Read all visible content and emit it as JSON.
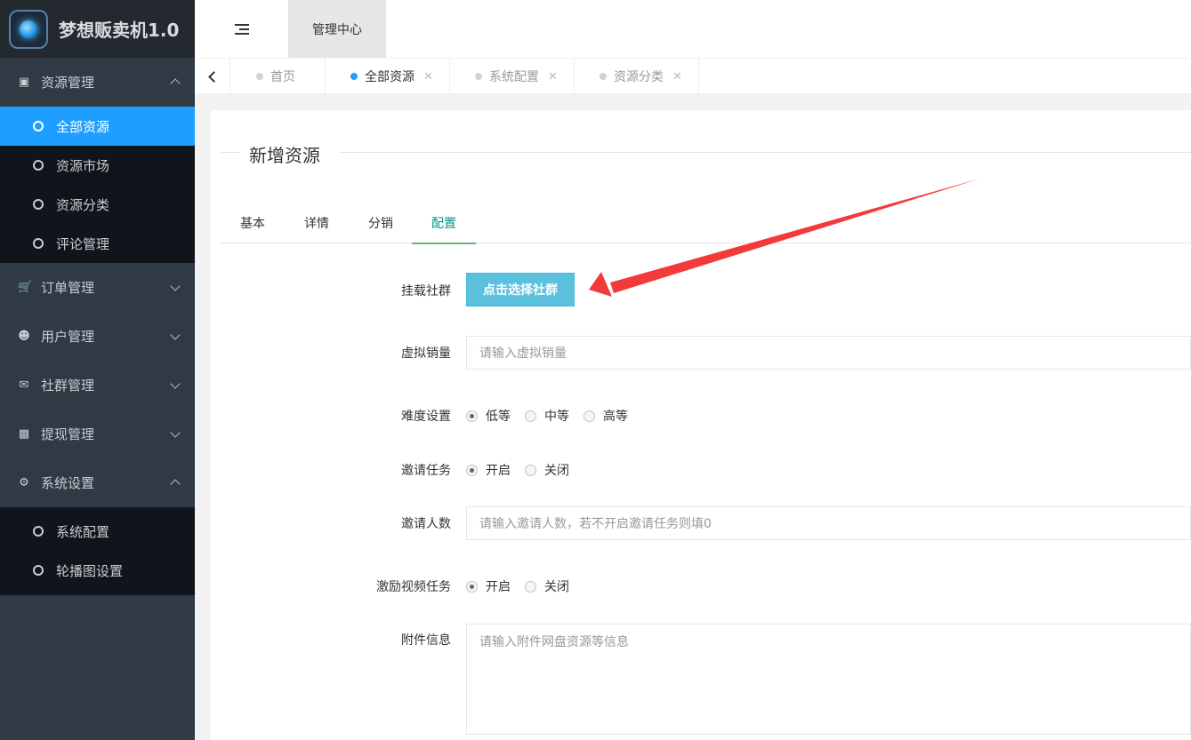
{
  "app": {
    "title": "梦想贩卖机1.0"
  },
  "sidebar": {
    "groups": [
      {
        "label": "资源管理",
        "icon": "book-icon",
        "expanded": true,
        "items": [
          {
            "label": "全部资源",
            "active": true
          },
          {
            "label": "资源市场"
          },
          {
            "label": "资源分类"
          },
          {
            "label": "评论管理"
          }
        ]
      },
      {
        "label": "订单管理",
        "icon": "cart-icon",
        "expanded": false
      },
      {
        "label": "用户管理",
        "icon": "users-icon",
        "expanded": false
      },
      {
        "label": "社群管理",
        "icon": "chat-icon",
        "expanded": false
      },
      {
        "label": "提现管理",
        "icon": "money-icon",
        "expanded": false
      },
      {
        "label": "系统设置",
        "icon": "gear-icon",
        "expanded": true,
        "items": [
          {
            "label": "系统配置"
          },
          {
            "label": "轮播图设置"
          }
        ]
      }
    ]
  },
  "header": {
    "tab": "管理中心"
  },
  "tabs": [
    {
      "label": "首页",
      "active": false
    },
    {
      "label": "全部资源",
      "active": true,
      "closable": true
    },
    {
      "label": "系统配置",
      "active": false,
      "closable": true
    },
    {
      "label": "资源分类",
      "active": false,
      "closable": true
    }
  ],
  "form": {
    "legend": "新增资源",
    "tabs": [
      "基本",
      "详情",
      "分销",
      "配置"
    ],
    "active_tab": "配置",
    "mount_group": {
      "label": "挂载社群",
      "button": "点击选择社群"
    },
    "virtual_sales": {
      "label": "虚拟销量",
      "placeholder": "请输入虚拟销量"
    },
    "difficulty": {
      "label": "难度设置",
      "options": [
        "低等",
        "中等",
        "高等"
      ],
      "selected": "低等"
    },
    "invite_task": {
      "label": "邀请任务",
      "options": [
        "开启",
        "关闭"
      ],
      "selected": "开启"
    },
    "invite_count": {
      "label": "邀请人数",
      "placeholder": "请输入邀请人数，若不开启邀请任务则填0"
    },
    "video_task": {
      "label": "激励视频任务",
      "options": [
        "开启",
        "关闭"
      ],
      "selected": "开启"
    },
    "attachment": {
      "label": "附件信息",
      "placeholder": "请输入附件网盘资源等信息"
    }
  },
  "colors": {
    "sidebar_bg": "#2f3a45",
    "active_blue": "#1e9fff",
    "button": "#5bc0de",
    "tab_green": "#009688",
    "arrow_red": "#f23a3a"
  }
}
